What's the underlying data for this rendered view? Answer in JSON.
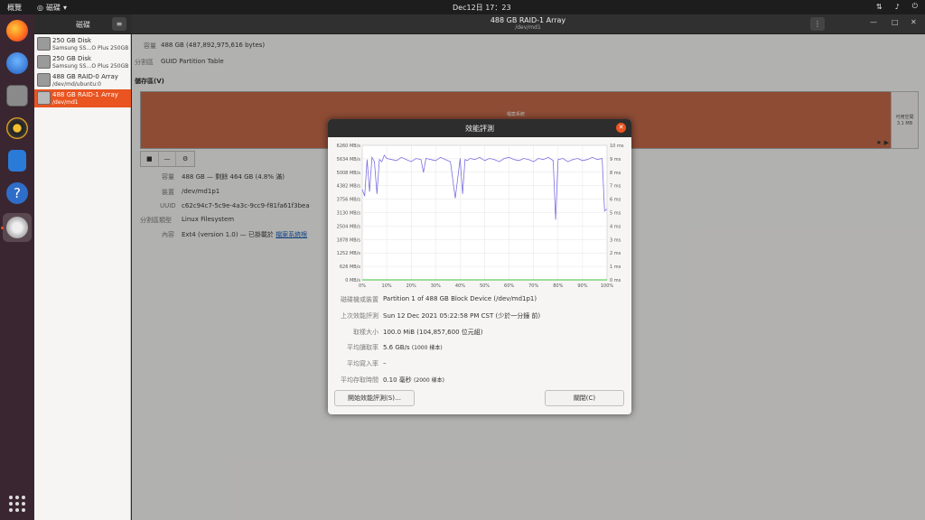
{
  "topbar": {
    "activities": "概覽",
    "app_menu": "磁碟",
    "clock": "Dec12日  17：23",
    "tray_icons": [
      "network-icon",
      "volume-icon",
      "power-icon"
    ]
  },
  "dock": {
    "apps": [
      "firefox-icon",
      "thunderbird-icon",
      "files-icon",
      "rhythmbox-icon",
      "writer-icon",
      "help-icon",
      "disks-icon"
    ],
    "show_apps": "apps-grid-icon"
  },
  "header": {
    "sidebar_title": "磁碟",
    "title": "488 GB RAID-1 Array",
    "subtitle": "/dev/md1"
  },
  "sidebar": {
    "items": [
      {
        "title": "250 GB Disk",
        "subtitle": "Samsung SS…O Plus 250GB"
      },
      {
        "title": "250 GB Disk",
        "subtitle": "Samsung SS…O Plus 250GB"
      },
      {
        "title": "488 GB RAID-0 Array",
        "subtitle": "/dev/md/ubuntu:0"
      },
      {
        "title": "488 GB RAID-1 Array",
        "subtitle": "/dev/md1"
      }
    ]
  },
  "main": {
    "size_label": "容量",
    "size_value": "488 GB (487,892,975,616 bytes)",
    "partitioning_label": "分割區",
    "partitioning_value": "GUID Partition Table",
    "volumes_heading": "儲存區(V)",
    "partition_label": "檔案系統",
    "free_label": "可用空間",
    "free_value": "3.1 MB",
    "tools": [
      "■",
      "—",
      "⚙"
    ],
    "details": [
      {
        "key": "容量",
        "value": "488 GB — 剩餘 464 GB (4.8% 滿)"
      },
      {
        "key": "裝置",
        "value": "/dev/md1p1"
      },
      {
        "key": "UUID",
        "value": "c62c94c7-5c9e-4a3c-9cc9-f81fa61f3bea"
      },
      {
        "key": "分割區類型",
        "value": "Linux Filesystem"
      },
      {
        "key": "內容",
        "value": "Ext4 (version 1.0) — 已掛載於 ",
        "link": "檔案系統根"
      }
    ]
  },
  "dialog": {
    "title": "效能評測",
    "rows": [
      {
        "key": "磁碟機或裝置",
        "value": "Partition 1 of 488 GB Block Device (/dev/md1p1)",
        "suffix": ""
      },
      {
        "key": "上次效能評測",
        "value": "Sun 12 Dec 2021 05:22:58 PM CST (少於一分鐘 前)",
        "suffix": ""
      },
      {
        "key": "取樣大小",
        "value": "100.0 MiB (104,857,600 位元組)",
        "suffix": ""
      },
      {
        "key": "平均讀取率",
        "value": "5.6 GB/s ",
        "suffix": "(1000 樣本)"
      },
      {
        "key": "平均寫入率",
        "value": "–",
        "suffix": ""
      },
      {
        "key": "平均存取時間",
        "value": "0.10 毫秒 ",
        "suffix": "(2000 樣本)"
      }
    ],
    "start_button": "開始效能評測(S)…",
    "close_button": "關閉(C)"
  },
  "chart_data": {
    "type": "line",
    "y_left_ticks": [
      "6260 MB/s",
      "5634 MB/s",
      "5008 MB/s",
      "4382 MB/s",
      "3756 MB/s",
      "3130 MB/s",
      "2504 MB/s",
      "1878 MB/s",
      "1252 MB/s",
      "626 MB/s",
      "0 MB/s"
    ],
    "y_right_ticks": [
      "10 ms",
      "9 ms",
      "8 ms",
      "7 ms",
      "6 ms",
      "5 ms",
      "4 ms",
      "3 ms",
      "2 ms",
      "1 ms",
      "0 ms"
    ],
    "x_ticks": [
      "0%",
      "10%",
      "20%",
      "30%",
      "40%",
      "50%",
      "60%",
      "70%",
      "80%",
      "90%",
      "100%"
    ],
    "ylim_left": [
      0,
      6260
    ],
    "ylim_right": [
      0,
      10
    ],
    "colors": {
      "read": "#7b6fe0",
      "write": "#3cc43c",
      "access": "#c8c8e8"
    },
    "read_rate_series": {
      "x": [
        0,
        1,
        2,
        3,
        4,
        5,
        6,
        7,
        8,
        9,
        10,
        12,
        14,
        16,
        18,
        20,
        22,
        24,
        25,
        26,
        28,
        30,
        32,
        34,
        36,
        38,
        40,
        41,
        42,
        43,
        44,
        46,
        48,
        50,
        52,
        54,
        56,
        58,
        60,
        62,
        64,
        66,
        68,
        70,
        72,
        74,
        76,
        78,
        79,
        80,
        82,
        84,
        86,
        88,
        90,
        92,
        94,
        96,
        98,
        99,
        100
      ],
      "y": [
        4200,
        3900,
        5600,
        4100,
        5700,
        5500,
        4000,
        5600,
        5500,
        5800,
        5650,
        5600,
        5550,
        5700,
        5600,
        5500,
        5650,
        5600,
        5000,
        5650,
        5600,
        5550,
        5700,
        5600,
        5500,
        3800,
        5650,
        4000,
        5600,
        5550,
        5650,
        5600,
        5700,
        5550,
        5650,
        5600,
        5500,
        5650,
        5700,
        5600,
        5550,
        5650,
        5600,
        5500,
        5650,
        5600,
        5700,
        5550,
        2800,
        5600,
        5650,
        5500,
        5600,
        5650,
        5550,
        5600,
        5700,
        5600,
        5650,
        3200,
        3300
      ]
    },
    "write_rate_series": {
      "x": [
        0,
        100
      ],
      "y": [
        0,
        0
      ]
    }
  }
}
